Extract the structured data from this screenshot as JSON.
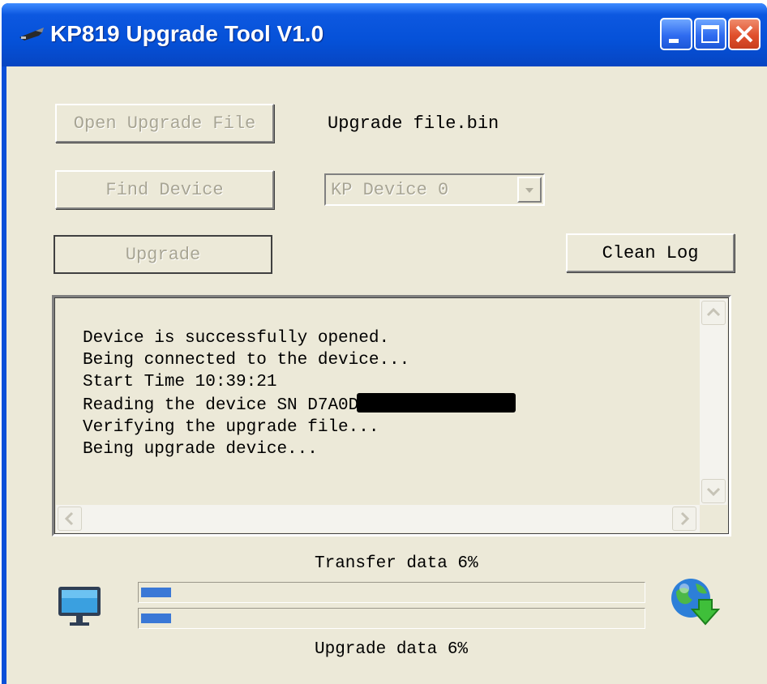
{
  "window": {
    "title": "KP819 Upgrade Tool V1.0",
    "titlebar_buttons": [
      "minimize-icon",
      "maximize-icon",
      "close-icon"
    ]
  },
  "toolbar": {
    "open_label": "Open Upgrade File",
    "file_name": "Upgrade file.bin",
    "find_label": "Find Device",
    "device_selected": "KP Device 0",
    "upgrade_label": "Upgrade",
    "clean_log_label": "Clean Log"
  },
  "log": {
    "lines": [
      "Device is successfully opened.",
      "Being connected to the device...",
      "Start Time 10:39:21",
      "Reading the device SN  D7A0D",
      "Verifying the upgrade file...",
      "Being upgrade device..."
    ]
  },
  "status": {
    "transfer_label": "Transfer data 6%",
    "upgrade_label": "Upgrade data 6%",
    "transfer_percent": 6,
    "upgrade_percent": 6
  },
  "colors": {
    "titlebar": "#0551d8",
    "face": "#ece9d8",
    "progress": "#3a78d6"
  },
  "icons": [
    "app-icon",
    "monitor-icon",
    "globe-download-icon"
  ]
}
